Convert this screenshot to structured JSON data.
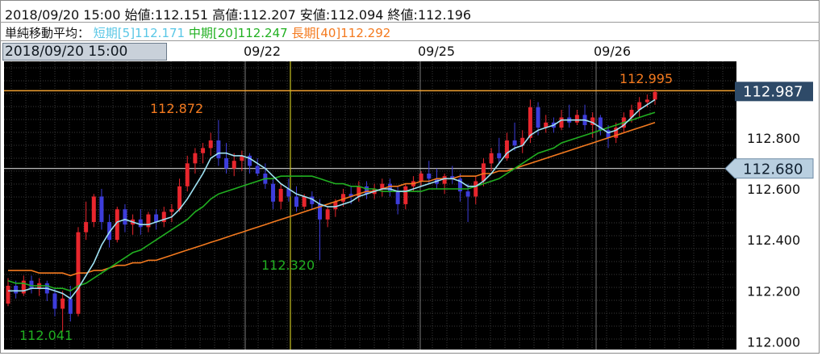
{
  "header": {
    "ohlc": {
      "date": "2018/09/20 15:00",
      "open_label": "始値:",
      "open": "112.151",
      "high_label": "高値:",
      "high": "112.207",
      "low_label": "安値:",
      "low": "112.094",
      "close_label": "終値:",
      "close": "112.196"
    },
    "ma": {
      "label": "単純移動平均：",
      "short": "短期[5]112.171",
      "mid": "中期[20]112.247",
      "long": "長期[40]112.292"
    }
  },
  "cursor_date": "2018/09/20 15:00",
  "colors": {
    "bg": "#000000",
    "up": "#e8262d",
    "down": "#3d3ddb",
    "ma_short": "#9fe2f3",
    "ma_mid": "#21b021",
    "ma_long": "#f47a1f",
    "hline_top": "#f0a030",
    "hline_cur": "#d0d0d0",
    "cursor_v": "#c8c020",
    "label_high": "#f47a1f",
    "label_low": "#21b021"
  },
  "chart_data": {
    "type": "candlestick",
    "x_ticks": [
      "09/22",
      "09/25",
      "09/26"
    ],
    "y_ticks": [
      "112.800",
      "112.600",
      "112.400",
      "112.200",
      "112.000"
    ],
    "ylim": [
      111.97,
      113.1
    ],
    "price_top": "112.987",
    "price_current": "112.680",
    "annotations": [
      {
        "text": "112.872",
        "type": "high"
      },
      {
        "text": "112.320",
        "type": "low"
      },
      {
        "text": "112.041",
        "type": "low"
      },
      {
        "text": "112.995",
        "type": "high"
      }
    ],
    "candles": [
      [
        112.15,
        112.25,
        112.14,
        112.22
      ],
      [
        112.22,
        112.24,
        112.17,
        112.19
      ],
      [
        112.19,
        112.26,
        112.18,
        112.24
      ],
      [
        112.24,
        112.26,
        112.19,
        112.21
      ],
      [
        112.21,
        112.25,
        112.18,
        112.23
      ],
      [
        112.23,
        112.24,
        112.16,
        112.19
      ],
      [
        112.19,
        112.21,
        112.1,
        112.13
      ],
      [
        112.13,
        112.2,
        112.04,
        112.17
      ],
      [
        112.17,
        112.22,
        112.08,
        112.11
      ],
      [
        112.11,
        112.45,
        112.1,
        112.43
      ],
      [
        112.43,
        112.55,
        112.4,
        112.47
      ],
      [
        112.47,
        112.58,
        112.45,
        112.57
      ],
      [
        112.57,
        112.6,
        112.44,
        112.47
      ],
      [
        112.47,
        112.5,
        112.37,
        112.4
      ],
      [
        112.4,
        112.53,
        112.39,
        112.52
      ],
      [
        112.52,
        112.54,
        112.43,
        112.46
      ],
      [
        112.46,
        112.5,
        112.42,
        112.48
      ],
      [
        112.48,
        112.52,
        112.42,
        112.45
      ],
      [
        112.45,
        112.51,
        112.43,
        112.5
      ],
      [
        112.5,
        112.52,
        112.44,
        112.47
      ],
      [
        112.47,
        112.53,
        112.45,
        112.51
      ],
      [
        112.51,
        112.54,
        112.47,
        112.52
      ],
      [
        112.52,
        112.64,
        112.51,
        112.61
      ],
      [
        112.61,
        112.73,
        112.59,
        112.7
      ],
      [
        112.7,
        112.76,
        112.66,
        112.74
      ],
      [
        112.74,
        112.78,
        112.7,
        112.76
      ],
      [
        112.76,
        112.82,
        112.73,
        112.79
      ],
      [
        112.79,
        112.87,
        112.69,
        112.72
      ],
      [
        112.72,
        112.78,
        112.66,
        112.68
      ],
      [
        112.68,
        112.74,
        112.65,
        112.71
      ],
      [
        112.71,
        112.75,
        112.67,
        112.73
      ],
      [
        112.73,
        112.74,
        112.66,
        112.69
      ],
      [
        112.69,
        112.72,
        112.65,
        112.66
      ],
      [
        112.66,
        112.7,
        112.6,
        112.62
      ],
      [
        112.62,
        112.64,
        112.52,
        112.55
      ],
      [
        112.55,
        112.62,
        112.52,
        112.6
      ],
      [
        112.6,
        112.64,
        112.55,
        112.57
      ],
      [
        112.57,
        112.61,
        112.51,
        112.53
      ],
      [
        112.53,
        112.58,
        112.52,
        112.57
      ],
      [
        112.57,
        112.59,
        112.52,
        112.54
      ],
      [
        112.54,
        112.56,
        112.32,
        112.48
      ],
      [
        112.48,
        112.53,
        112.45,
        112.52
      ],
      [
        112.52,
        112.56,
        112.49,
        112.55
      ],
      [
        112.55,
        112.6,
        112.53,
        112.58
      ],
      [
        112.58,
        112.61,
        112.54,
        112.57
      ],
      [
        112.57,
        112.63,
        112.55,
        112.61
      ],
      [
        112.61,
        112.63,
        112.56,
        112.58
      ],
      [
        112.58,
        112.62,
        112.56,
        112.6
      ],
      [
        112.6,
        112.64,
        112.57,
        112.62
      ],
      [
        112.62,
        112.64,
        112.57,
        112.59
      ],
      [
        112.59,
        112.61,
        112.5,
        112.54
      ],
      [
        112.54,
        112.62,
        112.52,
        112.61
      ],
      [
        112.61,
        112.65,
        112.59,
        112.63
      ],
      [
        112.63,
        112.67,
        112.61,
        112.66
      ],
      [
        112.66,
        112.71,
        112.62,
        112.64
      ],
      [
        112.64,
        112.68,
        112.6,
        112.62
      ],
      [
        112.62,
        112.66,
        112.58,
        112.65
      ],
      [
        112.65,
        112.69,
        112.62,
        112.64
      ],
      [
        112.64,
        112.66,
        112.55,
        112.59
      ],
      [
        112.59,
        112.62,
        112.47,
        112.57
      ],
      [
        112.57,
        112.65,
        112.54,
        112.63
      ],
      [
        112.63,
        112.72,
        112.61,
        112.7
      ],
      [
        112.7,
        112.76,
        112.67,
        112.74
      ],
      [
        112.74,
        112.8,
        112.7,
        112.72
      ],
      [
        112.72,
        112.82,
        112.71,
        112.79
      ],
      [
        112.79,
        112.86,
        112.75,
        112.77
      ],
      [
        112.77,
        112.83,
        112.74,
        112.8
      ],
      [
        112.8,
        112.95,
        112.78,
        112.92
      ],
      [
        112.92,
        112.94,
        112.81,
        112.84
      ],
      [
        112.84,
        112.89,
        112.82,
        112.86
      ],
      [
        112.86,
        112.88,
        112.82,
        112.84
      ],
      [
        112.84,
        112.91,
        112.83,
        112.88
      ],
      [
        112.88,
        112.93,
        112.84,
        112.86
      ],
      [
        112.86,
        112.91,
        112.85,
        112.89
      ],
      [
        112.89,
        112.93,
        112.83,
        112.85
      ],
      [
        112.85,
        112.9,
        112.8,
        112.88
      ],
      [
        112.88,
        112.89,
        112.81,
        112.83
      ],
      [
        112.83,
        112.85,
        112.76,
        112.8
      ],
      [
        112.8,
        112.86,
        112.78,
        112.84
      ],
      [
        112.84,
        112.9,
        112.82,
        112.88
      ],
      [
        112.88,
        112.93,
        112.86,
        112.91
      ],
      [
        112.91,
        112.96,
        112.88,
        112.94
      ],
      [
        112.94,
        112.97,
        112.92,
        112.95
      ],
      [
        112.95,
        112.99,
        112.93,
        112.98
      ]
    ],
    "ma_short": [
      112.2,
      112.2,
      112.2,
      112.21,
      112.21,
      112.21,
      112.2,
      112.19,
      112.17,
      112.21,
      112.26,
      112.31,
      112.38,
      112.43,
      112.47,
      112.48,
      112.47,
      112.46,
      112.46,
      112.47,
      112.48,
      112.49,
      112.52,
      112.56,
      112.61,
      112.66,
      112.72,
      112.74,
      112.74,
      112.73,
      112.73,
      112.72,
      112.7,
      112.68,
      112.65,
      112.62,
      112.6,
      112.58,
      112.57,
      112.56,
      112.54,
      112.53,
      112.53,
      112.54,
      112.55,
      112.57,
      112.58,
      112.59,
      112.6,
      112.6,
      112.59,
      112.59,
      112.6,
      112.61,
      112.62,
      112.63,
      112.64,
      112.64,
      112.63,
      112.61,
      112.61,
      112.63,
      112.66,
      112.7,
      112.74,
      112.76,
      112.77,
      112.81,
      112.83,
      112.84,
      112.85,
      112.87,
      112.87,
      112.87,
      112.87,
      112.86,
      112.84,
      112.82,
      112.83,
      112.85,
      112.88,
      112.91,
      112.93,
      112.95
    ],
    "ma_mid": [
      112.24,
      112.23,
      112.23,
      112.22,
      112.22,
      112.22,
      112.21,
      112.21,
      112.2,
      112.22,
      112.23,
      112.25,
      112.27,
      112.29,
      112.31,
      112.33,
      112.35,
      112.36,
      112.38,
      112.4,
      112.42,
      112.44,
      112.46,
      112.48,
      112.51,
      112.53,
      112.56,
      112.58,
      112.59,
      112.6,
      112.61,
      112.62,
      112.63,
      112.64,
      112.64,
      112.65,
      112.65,
      112.65,
      112.65,
      112.65,
      112.64,
      112.63,
      112.62,
      112.62,
      112.61,
      112.61,
      112.6,
      112.6,
      112.59,
      112.59,
      112.59,
      112.59,
      112.59,
      112.59,
      112.6,
      112.6,
      112.6,
      112.6,
      112.6,
      112.6,
      112.61,
      112.62,
      112.63,
      112.64,
      112.66,
      112.68,
      112.7,
      112.72,
      112.74,
      112.75,
      112.76,
      112.78,
      112.79,
      112.8,
      112.81,
      112.82,
      112.83,
      112.84,
      112.85,
      112.86,
      112.87,
      112.88,
      112.89,
      112.9
    ],
    "ma_long": [
      112.28,
      112.28,
      112.28,
      112.28,
      112.27,
      112.27,
      112.27,
      112.27,
      112.26,
      112.27,
      112.27,
      112.28,
      112.28,
      112.29,
      112.3,
      112.3,
      112.31,
      112.31,
      112.32,
      112.32,
      112.33,
      112.34,
      112.35,
      112.36,
      112.37,
      112.38,
      112.39,
      112.4,
      112.41,
      112.42,
      112.43,
      112.44,
      112.45,
      112.46,
      112.47,
      112.48,
      112.49,
      112.5,
      112.51,
      112.52,
      112.53,
      112.54,
      112.55,
      112.56,
      112.57,
      112.58,
      112.59,
      112.59,
      112.6,
      112.61,
      112.61,
      112.62,
      112.62,
      112.63,
      112.63,
      112.64,
      112.64,
      112.64,
      112.65,
      112.65,
      112.65,
      112.66,
      112.66,
      112.67,
      112.67,
      112.68,
      112.69,
      112.7,
      112.71,
      112.72,
      112.73,
      112.74,
      112.75,
      112.76,
      112.77,
      112.78,
      112.79,
      112.8,
      112.81,
      112.82,
      112.83,
      112.84,
      112.85,
      112.86
    ]
  }
}
